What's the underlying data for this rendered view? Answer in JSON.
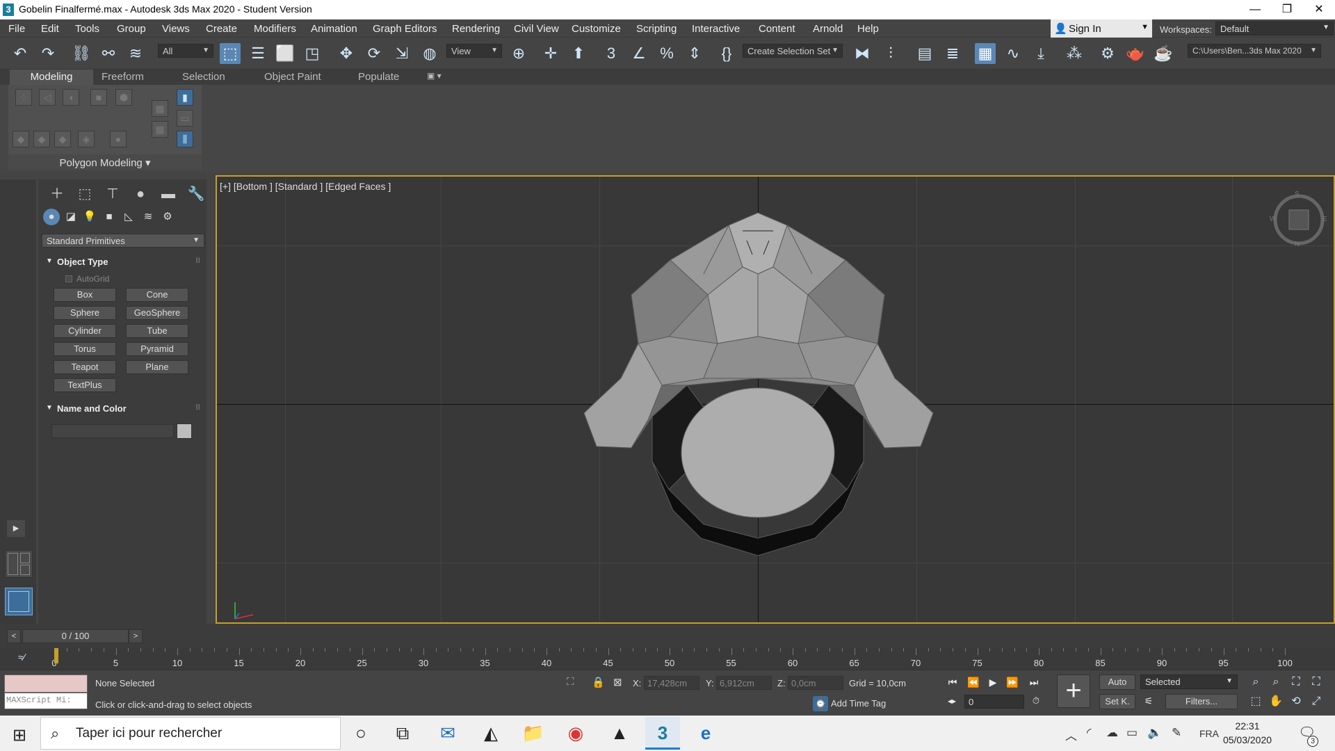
{
  "window": {
    "title": "Gobelin Finalfermé.max - Autodesk 3ds Max 2020 - Student Version",
    "app_icon": "3",
    "minimize": "—",
    "maximize": "❐",
    "close": "✕"
  },
  "menu": [
    "File",
    "Edit",
    "Tools",
    "Group",
    "Views",
    "Create",
    "Modifiers",
    "Animation",
    "Graph Editors",
    "Rendering",
    "Civil View",
    "Customize",
    "Scripting",
    "Interactive",
    "Content",
    "Arnold",
    "Help"
  ],
  "account": {
    "sign_in": "Sign In",
    "workspaces_label": "Workspaces:",
    "workspace": "Default"
  },
  "toolbar": {
    "filter": "All",
    "ref_coord": "View",
    "selection_set": "Create Selection Set",
    "project_path": "C:\\Users\\Ben...3ds Max 2020"
  },
  "ribbon": {
    "tabs": [
      "Modeling",
      "Freeform",
      "Selection",
      "Object Paint",
      "Populate"
    ],
    "panel_label": "Polygon Modeling"
  },
  "command_panel": {
    "category": "Standard Primitives",
    "object_type_title": "Object Type",
    "autogrid": "AutoGrid",
    "buttons": [
      "Box",
      "Cone",
      "Sphere",
      "GeoSphere",
      "Cylinder",
      "Tube",
      "Torus",
      "Pyramid",
      "Teapot",
      "Plane",
      "TextPlus"
    ],
    "name_color_title": "Name and Color"
  },
  "viewport": {
    "label": "[+] [Bottom ] [Standard ] [Edged Faces ]",
    "compass": {
      "n": "N",
      "s": "S",
      "e": "E",
      "w": "W"
    }
  },
  "timeline": {
    "frame": "0 / 100",
    "ticks": [
      "0",
      "5",
      "10",
      "15",
      "20",
      "25",
      "30",
      "35",
      "40",
      "45",
      "50",
      "55",
      "60",
      "65",
      "70",
      "75",
      "80",
      "85",
      "90",
      "95",
      "100"
    ]
  },
  "status": {
    "maxscript": "MAXScript Mi:",
    "selection": "None Selected",
    "prompt": "Click or click-and-drag to select objects",
    "x_label": "X:",
    "x": "17,428cm",
    "y_label": "Y:",
    "y": "6,912cm",
    "z_label": "Z:",
    "z": "0,0cm",
    "grid": "Grid = 10,0cm",
    "add_time_tag": "Add Time Tag",
    "frame_spinner": "0",
    "auto": "Auto",
    "set_key": "Set K.",
    "key_filter": "Selected",
    "filters": "Filters..."
  },
  "taskbar": {
    "search": "Taper ici pour rechercher",
    "language": "FRA",
    "time": "22:31",
    "date": "05/03/2020",
    "notifications": "3"
  }
}
